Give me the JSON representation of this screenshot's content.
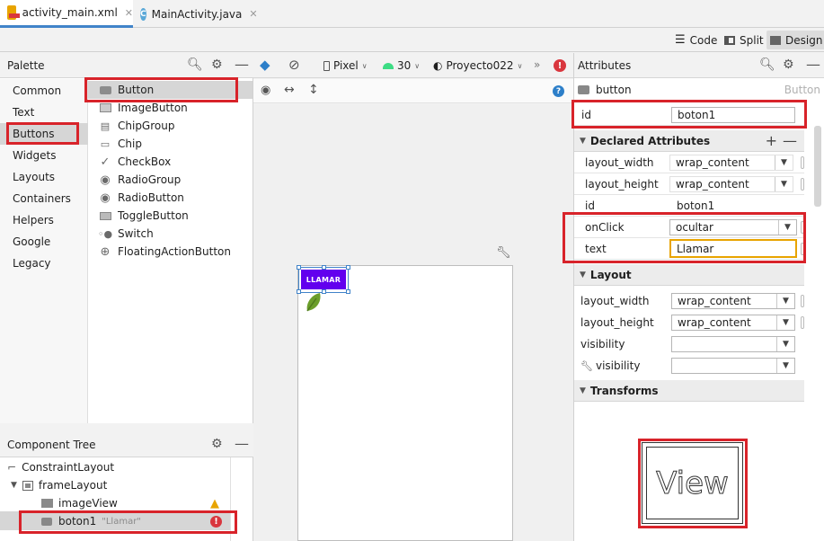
{
  "tabs": [
    {
      "label": "activity_main.xml",
      "icon": "xml-layout-icon",
      "active": true
    },
    {
      "label": "MainActivity.java",
      "icon": "class-c-icon",
      "active": false
    }
  ],
  "modes": {
    "code": "Code",
    "split": "Split",
    "design": "Design"
  },
  "palette": {
    "title": "Palette",
    "categories": [
      "Common",
      "Text",
      "Buttons",
      "Widgets",
      "Layouts",
      "Containers",
      "Helpers",
      "Google",
      "Legacy"
    ],
    "selected_category": "Buttons",
    "items": [
      "Button",
      "ImageButton",
      "ChipGroup",
      "Chip",
      "CheckBox",
      "RadioGroup",
      "RadioButton",
      "ToggleButton",
      "Switch",
      "FloatingActionButton"
    ]
  },
  "toolbar": {
    "device": "Pixel",
    "api": "30",
    "theme": "Proyecto022",
    "more": "»"
  },
  "component_tree": {
    "title": "Component Tree",
    "nodes": [
      {
        "label": "ConstraintLayout"
      },
      {
        "label": "frameLayout"
      },
      {
        "label": "imageView"
      },
      {
        "label": "boton1",
        "hint": "\"Llamar\""
      }
    ]
  },
  "canvas": {
    "button_text": "LLAMAR"
  },
  "attributes": {
    "title": "Attributes",
    "component": "button",
    "component_class": "Button",
    "id_label": "id",
    "id_value": "boton1",
    "declared_title": "Declared Attributes",
    "declared": [
      {
        "name": "layout_width",
        "value": "wrap_content"
      },
      {
        "name": "layout_height",
        "value": "wrap_content"
      },
      {
        "name": "id",
        "value": "boton1"
      },
      {
        "name": "onClick",
        "value": "ocultar"
      },
      {
        "name": "text",
        "value": "Llamar"
      }
    ],
    "layout_title": "Layout",
    "layout": [
      {
        "name": "layout_width",
        "value": "wrap_content"
      },
      {
        "name": "layout_height",
        "value": "wrap_content"
      },
      {
        "name": "visibility",
        "value": ""
      },
      {
        "name": "visibility",
        "value": ""
      }
    ],
    "transforms_title": "Transforms",
    "preview_text": "View"
  },
  "colors": {
    "accent": "#4083c9",
    "button_purple": "#6200ee",
    "highlight_red": "#d8232a",
    "warning": "#e8a400",
    "error": "#d9363e",
    "android_green": "#3ddc84"
  }
}
